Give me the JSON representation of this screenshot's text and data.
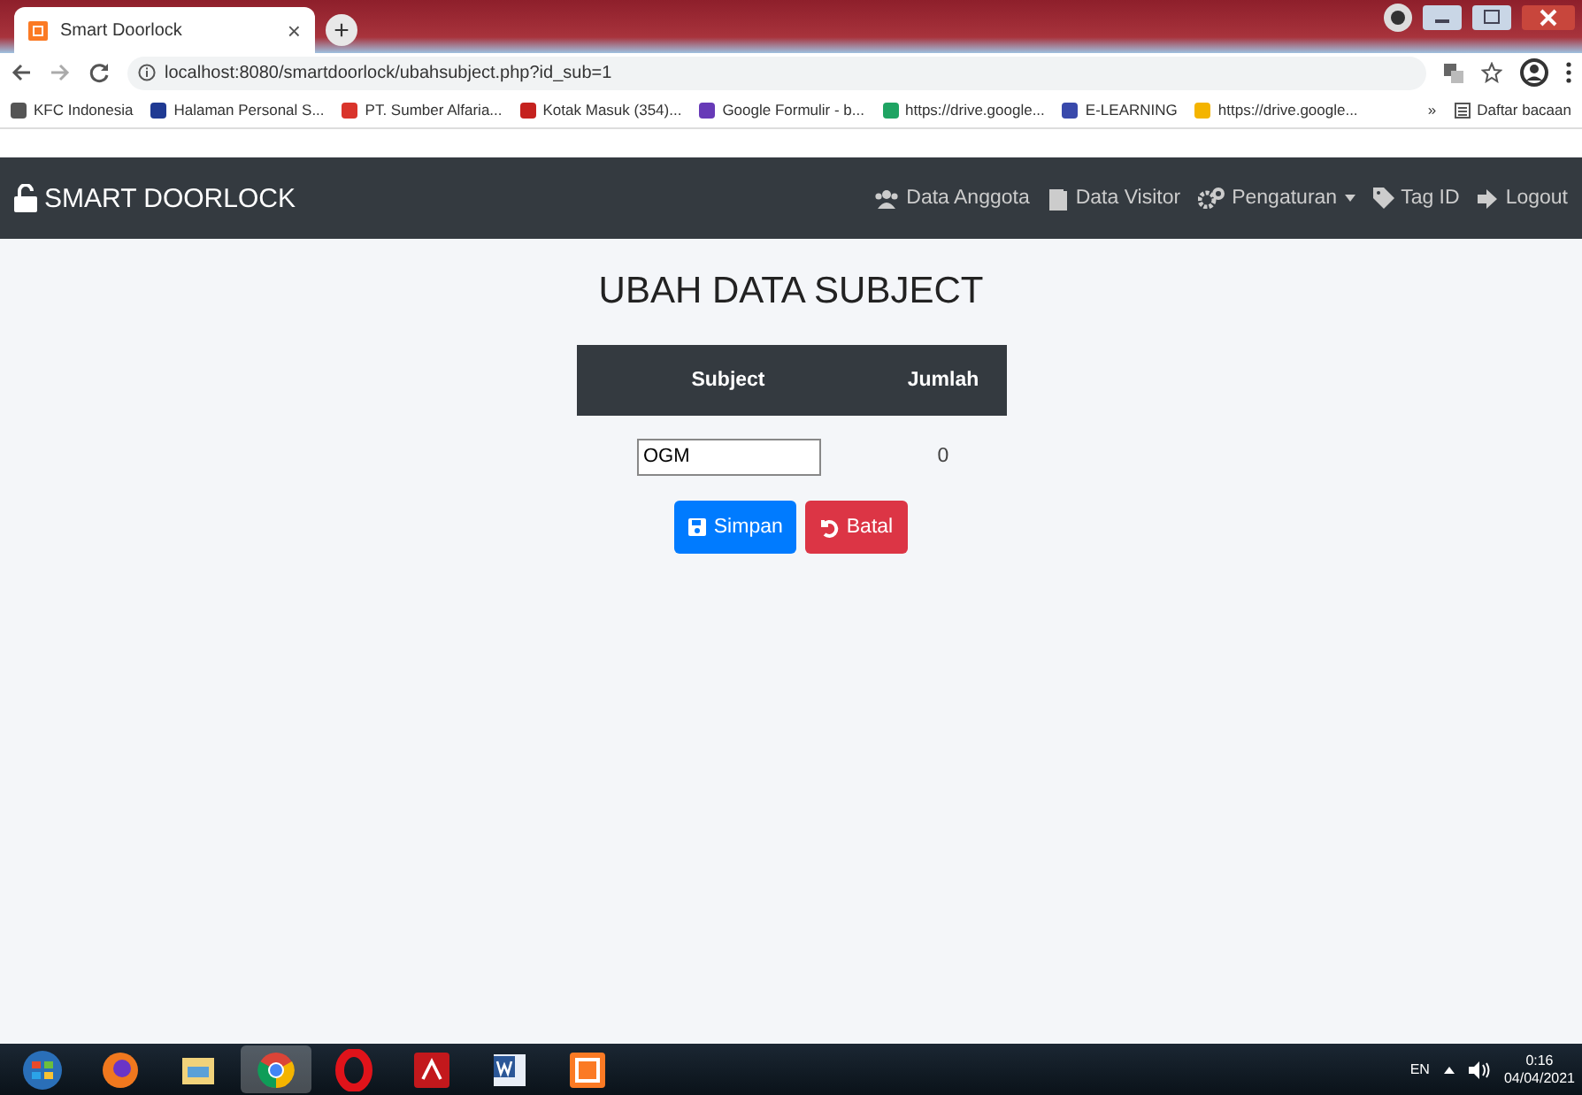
{
  "browser": {
    "tab_title": "Smart Doorlock",
    "tab_close": "×",
    "new_tab": "+",
    "url": "localhost:8080/smartdoorlock/ubahsubject.php?id_sub=1",
    "bookmarks": [
      {
        "label": "KFC Indonesia",
        "color": "#555555"
      },
      {
        "label": "Halaman Personal S...",
        "color": "#1f3a93"
      },
      {
        "label": "PT. Sumber Alfaria...",
        "color": "#d9342b"
      },
      {
        "label": "Kotak Masuk (354)...",
        "color": "#c5221f"
      },
      {
        "label": "Google Formulir - b...",
        "color": "#673ab7"
      },
      {
        "label": "https://drive.google...",
        "color": "#1fa463"
      },
      {
        "label": "E-LEARNING",
        "color": "#3949ab"
      },
      {
        "label": "https://drive.google...",
        "color": "#f4b400"
      }
    ],
    "more": "»",
    "reading_list": "Daftar bacaan"
  },
  "navbar": {
    "brand": "SMART DOORLOCK",
    "items": [
      {
        "label": "Data Anggota",
        "kind": "users"
      },
      {
        "label": "Data Visitor",
        "kind": "door"
      },
      {
        "label": "Pengaturan",
        "kind": "gears",
        "dropdown": true
      },
      {
        "label": "Tag ID",
        "kind": "tag"
      },
      {
        "label": "Logout",
        "kind": "logout"
      }
    ]
  },
  "page": {
    "title": "UBAH DATA SUBJECT",
    "table": {
      "columns": [
        "Subject",
        "Jumlah"
      ],
      "rows": [
        {
          "subject": "OGM",
          "jumlah": "0"
        }
      ]
    },
    "buttons": [
      {
        "label": "Simpan",
        "kind": "save"
      },
      {
        "label": "Batal",
        "kind": "cancel"
      }
    ]
  },
  "taskbar": {
    "apps": [
      {
        "kind": "start",
        "selected": false
      },
      {
        "kind": "firefox",
        "selected": false
      },
      {
        "kind": "explorer",
        "selected": false
      },
      {
        "kind": "chrome",
        "selected": true
      },
      {
        "kind": "opera",
        "selected": false
      },
      {
        "kind": "pdf",
        "selected": false
      },
      {
        "kind": "word",
        "selected": false
      },
      {
        "kind": "xampp",
        "selected": false
      }
    ],
    "lang": "EN",
    "time": "0:16",
    "date": "04/04/2021"
  }
}
